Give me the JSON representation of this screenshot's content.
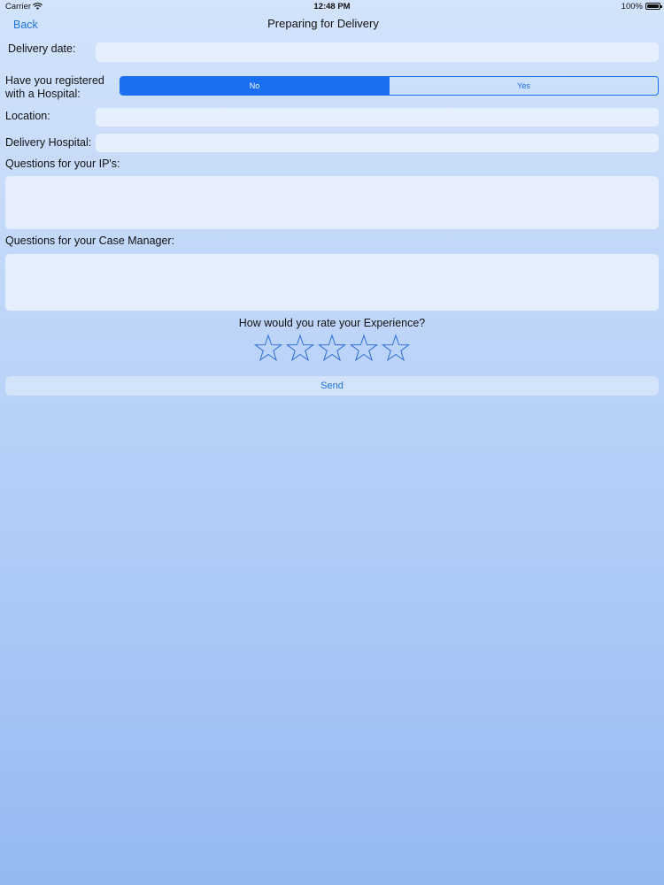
{
  "status_bar": {
    "carrier": "Carrier",
    "time": "12:48 PM",
    "battery": "100%"
  },
  "nav": {
    "back_label": "Back",
    "title": "Preparing for Delivery"
  },
  "form": {
    "delivery_date_label": "Delivery date:",
    "delivery_date_value": "",
    "registered_label_line1": "Have you registered",
    "registered_label_line2": "with a Hospital:",
    "registered_options": [
      "No",
      "Yes"
    ],
    "registered_selected": "No",
    "location_label": "Location:",
    "location_value": "",
    "delivery_hospital_label": "Delivery Hospital:",
    "delivery_hospital_value": "",
    "questions_ip_label": "Questions for your IP's:",
    "questions_ip_value": "",
    "questions_case_manager_label": "Questions for your Case Manager:",
    "questions_case_manager_value": ""
  },
  "rating": {
    "prompt": "How would you rate your Experience?",
    "max_stars": 5,
    "selected_stars": 0,
    "star_icon": "star-outline-icon",
    "star_color": "#2f6fd6"
  },
  "send_label": "Send",
  "colors": {
    "accent": "#1a6ff0",
    "link": "#1e72d8",
    "background_top": "#d2e3fb",
    "background_bottom": "#93b9f1"
  }
}
